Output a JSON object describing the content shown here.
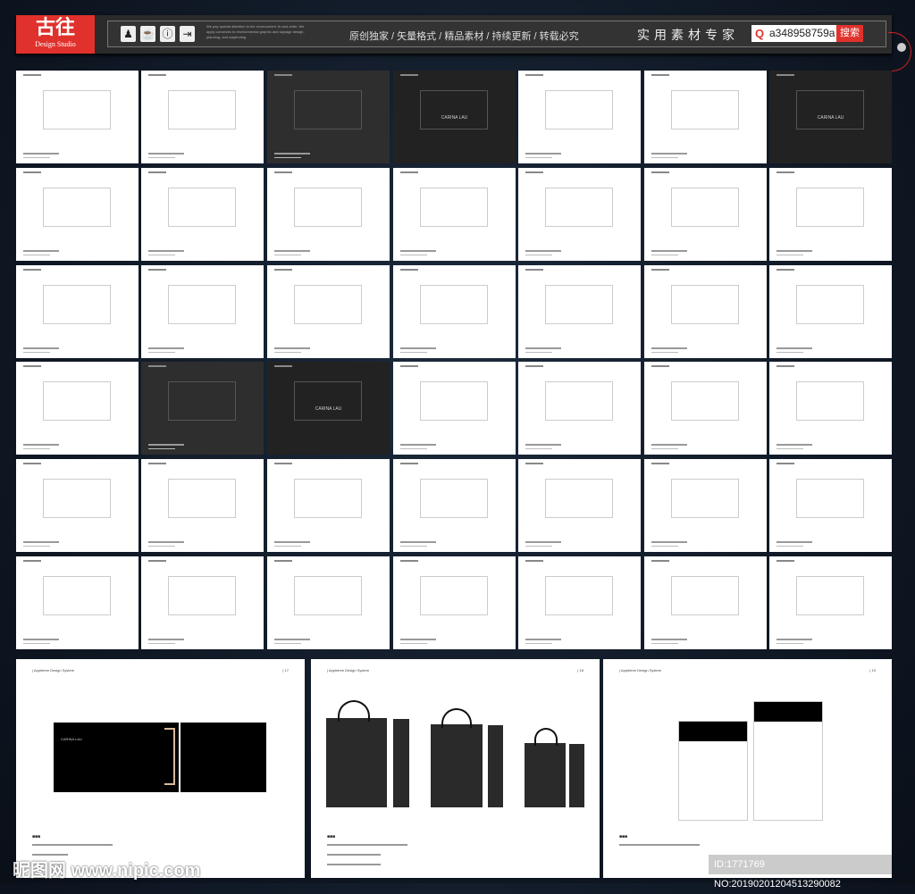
{
  "header": {
    "logo_mark": "古往",
    "logo_sub": "Design Studio",
    "icons": [
      "person-icon",
      "cup-icon",
      "info-icon",
      "exit-icon"
    ],
    "tiny_text": "We pay special attention to the environment. fe and order. We apply ourselves to environmental graphic and signage design, planning, and wayfinding.",
    "slogan": "原创独家 / 矢量格式 / 精品素材 / 持续更新 / 转载必究",
    "expert": "实用素材专家",
    "search_value": "a348958759a",
    "search_button": "搜索",
    "accent": "#e0312c"
  },
  "thumbs": [
    [
      "white",
      "white",
      "dark",
      "black",
      "white",
      "white",
      "black"
    ],
    [
      "white",
      "white",
      "white",
      "white",
      "white",
      "white",
      "white"
    ],
    [
      "white",
      "white",
      "white",
      "white",
      "white",
      "white",
      "white"
    ],
    [
      "white",
      "dark",
      "black",
      "white",
      "white",
      "white",
      "white"
    ],
    [
      "white",
      "white",
      "white",
      "white",
      "white",
      "white",
      "white"
    ],
    [
      "white",
      "white",
      "white",
      "white",
      "white",
      "white",
      "white"
    ]
  ],
  "brand": "CARINA LAU",
  "large_pages": [
    {
      "kind": "folder"
    },
    {
      "kind": "bags"
    },
    {
      "kind": "envelopes"
    }
  ],
  "watermark": "昵图网 www.nipic.com",
  "image_id": "ID:1771769 NO:20190201204513290082"
}
